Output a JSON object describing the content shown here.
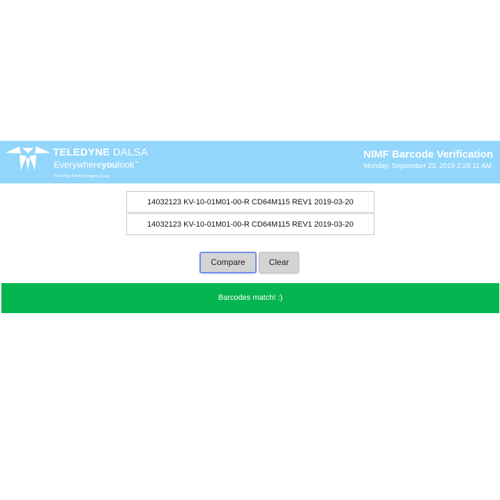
{
  "header": {
    "logo": {
      "brand_bold": "TELEDYNE",
      "brand_light": "DALSA",
      "tagline_prefix": "Everywhere",
      "tagline_bold": "you",
      "tagline_suffix": "look",
      "tagline_mark": "™",
      "subtext": "Part of the Teledyne Imaging Group"
    },
    "title": "NIMF Barcode Verification",
    "datetime": "Monday, September 23, 2019 2:28:11 AM",
    "background_color": "#92d6fb"
  },
  "form": {
    "barcode_1": "14032123 KV-10-01M01-00-R CD64M115 REV1 2019-03-20",
    "barcode_2": "14032123 KV-10-01M01-00-R CD64M115 REV1 2019-03-20"
  },
  "actions": {
    "compare_label": "Compare",
    "clear_label": "Clear"
  },
  "result": {
    "message": "Barcodes match! :)",
    "status": "match",
    "color": "#05b550"
  }
}
